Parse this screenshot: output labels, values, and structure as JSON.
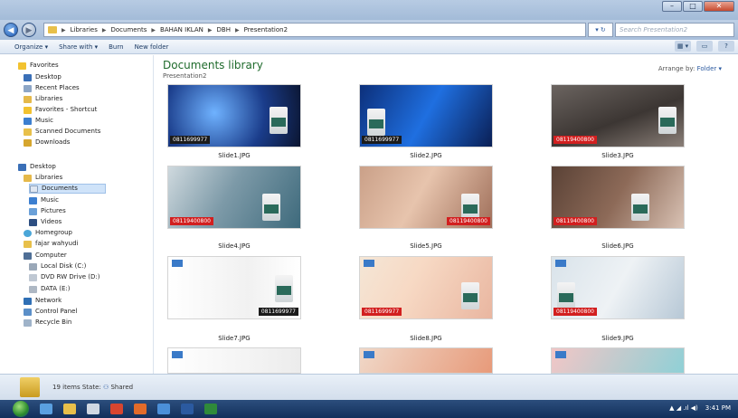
{
  "window": {
    "caption_min": "–",
    "caption_max": "□",
    "caption_close": "✕"
  },
  "address": {
    "back": "◀",
    "forward": "▶",
    "crumbs": [
      "Libraries",
      "Documents",
      "BAHAN IKLAN",
      "DBH",
      "Presentation2"
    ],
    "refresh": "▾ ↻",
    "search_placeholder": "Search Presentation2"
  },
  "toolbar": {
    "organize": "Organize ▾",
    "share": "Share with ▾",
    "burn": "Burn",
    "new_folder": "New folder",
    "view": "▦ ▾",
    "pane": "▭",
    "help": "?"
  },
  "nav": {
    "favorites": "Favorites",
    "desktop": "Desktop",
    "recent": "Recent Places",
    "libraries": "Libraries",
    "favorites_shortcut": "Favorites - Shortcut",
    "music_fav": "Music",
    "scanned": "Scanned Documents",
    "downloads": "Downloads",
    "desktop2": "Desktop",
    "libraries2": "Libraries",
    "documents": "Documents",
    "music": "Music",
    "pictures": "Pictures",
    "videos": "Videos",
    "homegroup": "Homegroup",
    "user": "fajar wahyudi",
    "computer": "Computer",
    "local_disk": "Local Disk (C:)",
    "dvd": "DVD RW Drive (D:)",
    "data": "DATA (E:)",
    "network": "Network",
    "control_panel": "Control Panel",
    "recycle": "Recycle Bin"
  },
  "content": {
    "title": "Documents library",
    "subtitle": "Presentation2",
    "arrange_label": "Arrange by:",
    "arrange_value": "Folder ▾"
  },
  "files": [
    {
      "name": "Slide1.JPG",
      "phone": "0811699977"
    },
    {
      "name": "Slide2.JPG",
      "phone": "0811699977"
    },
    {
      "name": "Slide3.JPG",
      "phone": "08119400800"
    },
    {
      "name": "Slide4.JPG",
      "phone": "08119400800"
    },
    {
      "name": "Slide5.JPG",
      "phone": "08119400800"
    },
    {
      "name": "Slide6.JPG",
      "phone": "08119400800"
    },
    {
      "name": "Slide7.JPG",
      "phone": "0811699977"
    },
    {
      "name": "Slide8.JPG",
      "phone": "0811699977"
    },
    {
      "name": "Slide9.JPG",
      "phone": "08119400800"
    }
  ],
  "status": {
    "count": "19 items",
    "state_label": "State:",
    "state_value": "Shared"
  },
  "taskbar": {
    "clock": "3:41 PM",
    "tray": "▲ ◢ .ıl ◀)"
  }
}
